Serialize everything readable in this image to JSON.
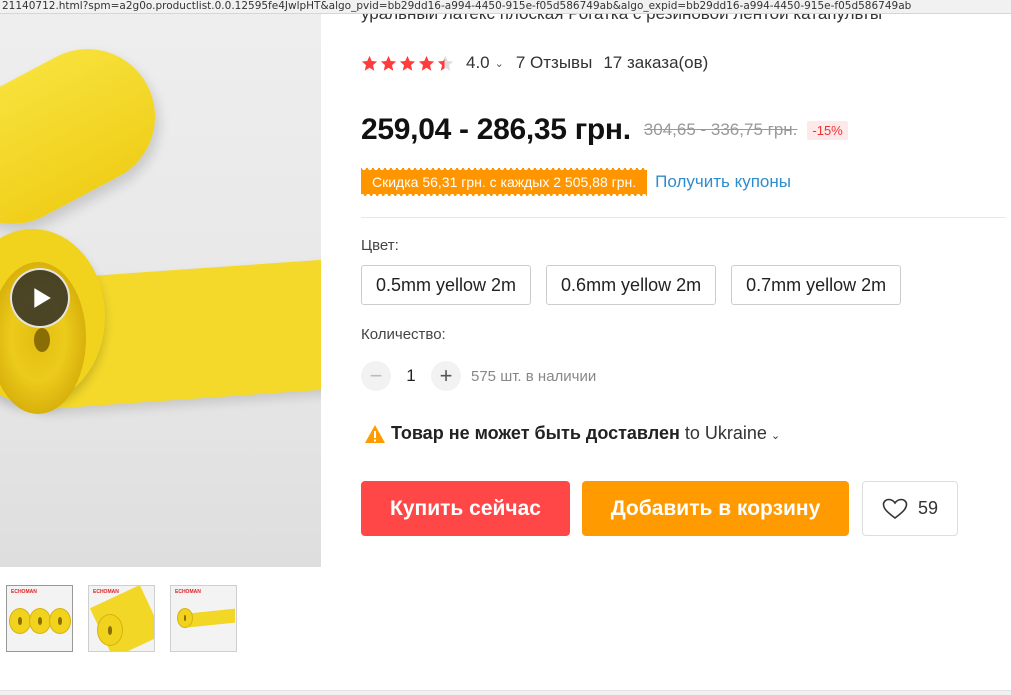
{
  "status_url": "21140712.html?spm=a2g0o.productlist.0.0.12595fe4JwlpHT&algo_pvid=bb29dd16-a994-4450-915e-f05d586749ab&algo_expid=bb29dd16-a994-4450-915e-f05d586749ab",
  "product": {
    "title_partial": "уральный латекс плоская Рогатка с резиновой лентой катапульты",
    "rating": "4.0",
    "reviews": "7 Отзывы",
    "orders": "17 заказа(ов)",
    "price": "259,04 - 286,35 грн.",
    "old_price": "304,65 - 336,75 грн.",
    "discount": "-15%",
    "coupon": "Скидка 56,31 грн. с каждых 2 505,88 грн.",
    "coupon_link": "Получить купоны",
    "color_label": "Цвет:",
    "variants": [
      "0.5mm yellow 2m",
      "0.6mm yellow 2m",
      "0.7mm yellow 2m"
    ],
    "quantity_label": "Количество:",
    "quantity": "1",
    "stock": "575 шт. в наличии",
    "shipping_warning": "Товар не может быть доставлен",
    "shipping_country": "to Ukraine",
    "buy_now": "Купить сейчас",
    "add_to_cart": "Добавить в корзину",
    "wishlist_count": "59",
    "thumb_brand": "ECHOMAN"
  },
  "colors": {
    "buy": "#ff4747",
    "cart": "#ff9a00",
    "coupon": "#ff9600",
    "star": "#ff3b3b",
    "link": "#2f8ccf",
    "product": "#f4d92a"
  },
  "icons": [
    "play-icon",
    "star-icon",
    "chevron-down-icon",
    "minus-icon",
    "plus-icon",
    "warning-icon",
    "heart-icon"
  ]
}
